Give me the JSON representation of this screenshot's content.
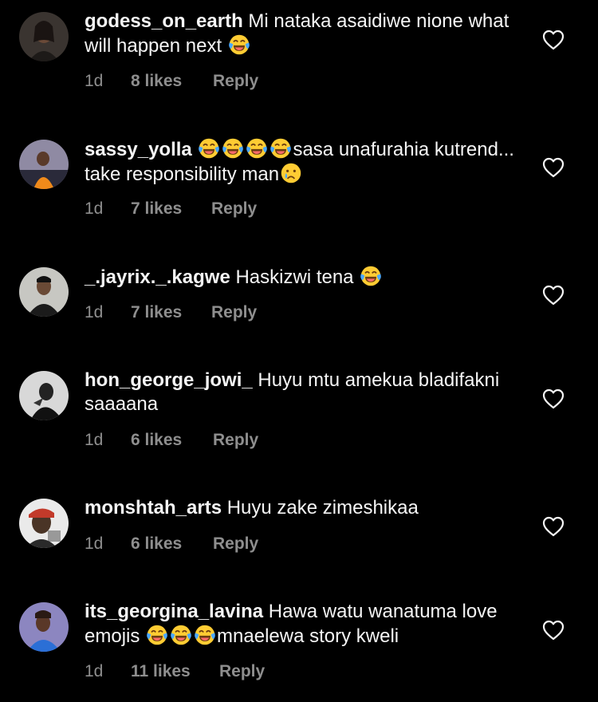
{
  "colors": {
    "background": "#000000",
    "text": "#f5f5f5",
    "meta": "#8e8e8e"
  },
  "comments": [
    {
      "username": "godess_on_earth",
      "text_before": "Mi nataka asaidiwe nione what will happen next",
      "emojis": [
        "tears-of-joy-emoji"
      ],
      "text_after": "",
      "time": "1d",
      "likes": "8 likes",
      "reply": "Reply"
    },
    {
      "username": "sassy_yolla",
      "text_before": "",
      "emojis": [
        "tears-of-joy-emoji",
        "tears-of-joy-emoji",
        "tears-of-joy-emoji",
        "tears-of-joy-emoji"
      ],
      "text_after": "sasa unafurahia kutrend... take responsibility man",
      "trailing_emoji": "crying-emoji",
      "time": "1d",
      "likes": "7 likes",
      "reply": "Reply"
    },
    {
      "username": "_.jayrix._.kagwe",
      "text_before": "Haskizwi tena",
      "emojis": [
        "tears-of-joy-emoji"
      ],
      "text_after": "",
      "time": "1d",
      "likes": "7 likes",
      "reply": "Reply"
    },
    {
      "username": "hon_george_jowi_",
      "text_before": "Huyu mtu amekua bladifakni saaaana",
      "emojis": [],
      "text_after": "",
      "time": "1d",
      "likes": "6 likes",
      "reply": "Reply"
    },
    {
      "username": "monshtah_arts",
      "text_before": "Huyu zake zimeshikaa",
      "emojis": [],
      "text_after": "",
      "time": "1d",
      "likes": "6 likes",
      "reply": "Reply"
    },
    {
      "username": "its_georgina_lavina",
      "text_before": "Hawa watu wanatuma love emojis",
      "emojis": [
        "tears-of-joy-emoji",
        "tears-of-joy-emoji",
        "tears-of-joy-emoji"
      ],
      "text_after": "mnaelewa story kweli",
      "time": "1d",
      "likes": "11 likes",
      "reply": "Reply"
    }
  ]
}
